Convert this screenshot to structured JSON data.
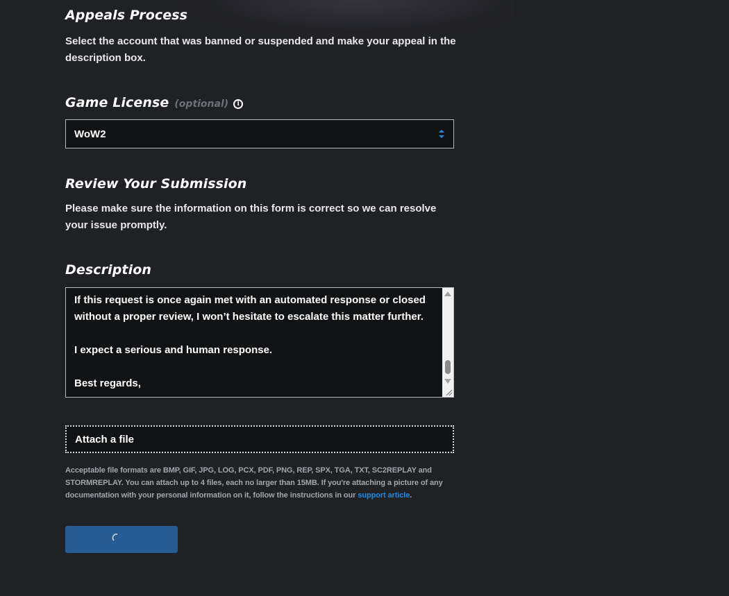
{
  "appeals": {
    "title": "Appeals Process",
    "text": "Select the account that was banned or suspended and make your appeal in the description box."
  },
  "game_license": {
    "label": "Game License",
    "optional_label": "(optional)",
    "info_icon": "info-circle-icon",
    "selected_value": "WoW2",
    "select_arrow_icon": "chevron-up-down-icon"
  },
  "review": {
    "title": "Review Your Submission",
    "text": "Please make sure the information on this form is correct so we can resolve your issue promptly."
  },
  "description": {
    "label": "Description",
    "visible_lines": [
      "If this request is once again met with an automated response or closed without a proper review, I won’t hesitate to escalate this matter further.",
      "I expect a serious and human response.",
      "Best regards,"
    ]
  },
  "attachment": {
    "label": "Attach a file",
    "info_text": "Acceptable file formats are BMP, GIF, JPG, LOG, PCX, PDF, PNG, REP, SPX, TGA, TXT, SC2REPLAY and STORMREPLAY. You can attach up to 4 files, each no larger than 15MB. If you're attaching a picture of any documentation with your personal information on it, follow the instructions in our",
    "link_text": "support article",
    "info_suffix": "."
  },
  "submit": {
    "state": "loading",
    "spinner_icon": "loading-spinner-icon"
  },
  "colors": {
    "background": "#202125",
    "field_background": "#111214",
    "field_border": "#b9bac0",
    "button": "#275b94",
    "link": "#1f8ae0",
    "select_arrows": "#1a8fe8"
  }
}
